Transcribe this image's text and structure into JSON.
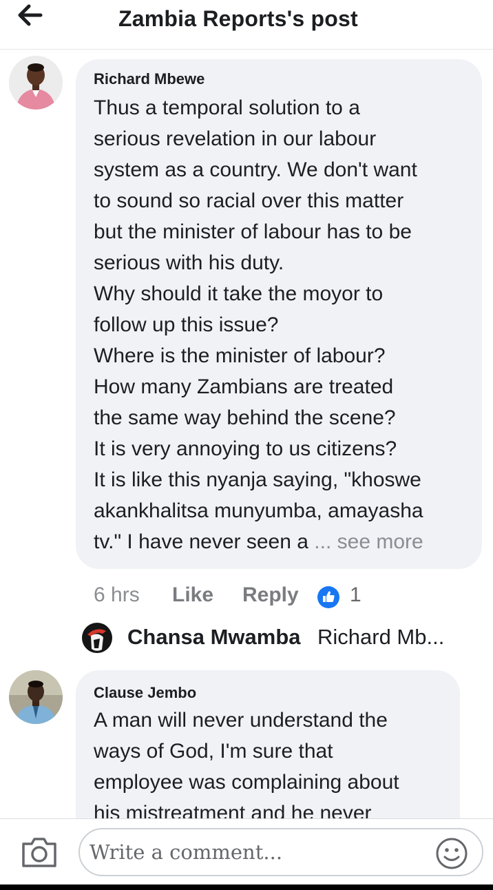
{
  "header": {
    "title": "Zambia Reports's post",
    "back_icon": "arrow-left-icon"
  },
  "comments": [
    {
      "author": "Richard Mbewe",
      "lines": [
        "Thus a temporal solution to a",
        "serious revelation in our labour",
        "system as a country. We don't want",
        "to sound so racial over this matter",
        "but the minister of labour has to be",
        "serious with his duty.",
        "Why should it take the moyor to",
        "follow up this issue?",
        "Where is the minister of labour?",
        "How many Zambians are treated",
        "the same way behind the scene?",
        "It is very annoying to us citizens?",
        "It is like this nyanja saying, \"khoswe",
        "akankhalitsa munyumba, amayasha",
        "tv.\" I have never seen a"
      ],
      "see_more": "... see more",
      "time": "6 hrs",
      "like_label": "Like",
      "reply_label": "Reply",
      "reaction_count": "1",
      "reply": {
        "author": "Chansa Mwamba",
        "snippet": "Richard Mb..."
      }
    },
    {
      "author": "Clause Jembo",
      "lines": [
        "A man will never understand the",
        "ways of God, I'm sure that",
        "employee was complaining about",
        "his mistreatment and he never"
      ]
    }
  ],
  "composer": {
    "placeholder": "Write a comment...",
    "camera_icon": "camera-icon",
    "emoji_icon": "smiley-icon"
  },
  "colors": {
    "bubble": "#f0f2f5",
    "like_blue": "#1877f2",
    "muted": "#65676b"
  }
}
